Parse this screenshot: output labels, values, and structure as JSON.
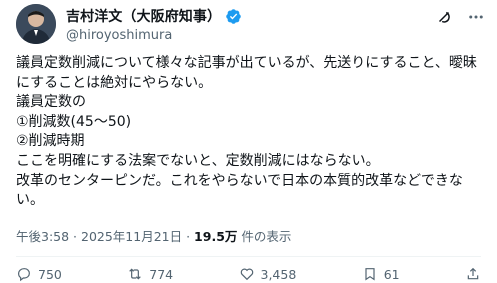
{
  "author": {
    "display_name": "吉村洋文（大阪府知事）",
    "handle": "@hiroyoshimura"
  },
  "tweet": {
    "text": "議員定数削減について様々な記事が出ているが、先送りにすること、曖昧にすることは絶対にやらない。\n議員定数の\n①削減数(45〜50)\n②削減時期\nここを明確にする法案でないと、定数削減にはならない。\n改革のセンターピンだ。これをやらないで日本の本質的改革などできない。"
  },
  "meta": {
    "timestamp": "午後3:58 · 2025年11月21日 · ",
    "views": "19.5万",
    "views_suffix": " 件の表示"
  },
  "actions": {
    "replies": "750",
    "reposts": "774",
    "likes": "3,458",
    "bookmarks": "61"
  },
  "icons": {
    "verified": "verified-badge-icon",
    "grok": "grok-icon",
    "more": "more-icon"
  },
  "colors": {
    "verified_blue": "#1d9bf0",
    "secondary_text": "#536471"
  }
}
